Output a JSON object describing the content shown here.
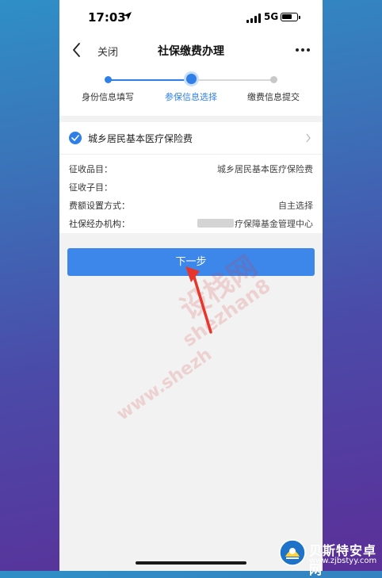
{
  "status_bar": {
    "time": "17:03",
    "network": "5G",
    "icons": [
      "location-arrow-icon",
      "signal-icon",
      "battery-icon"
    ]
  },
  "nav": {
    "close_label": "关闭",
    "title": "社保缴费办理",
    "icons": [
      "back-chevron-icon",
      "more-dots-icon"
    ]
  },
  "steps": {
    "current_index": 1,
    "items": [
      {
        "label": "身份信息填写",
        "state": "done"
      },
      {
        "label": "参保信息选择",
        "state": "active"
      },
      {
        "label": "缴费信息提交",
        "state": "pending"
      }
    ]
  },
  "plan": {
    "name": "城乡居民基本医疗保险费",
    "selected": true
  },
  "details": [
    {
      "label": "征收品目：",
      "value": "城乡居民基本医疗保险费"
    },
    {
      "label": "征收子目：",
      "value": ""
    },
    {
      "label": "费额设置方式：",
      "value": "自主选择"
    },
    {
      "label": "社保经办机构：",
      "value": "疗保障基金管理中心"
    }
  ],
  "next_button_label": "下一步",
  "watermark": {
    "line1": "设栈网",
    "line2": "shezhan8",
    "line3": "www.shezh"
  },
  "logo": {
    "name": "贝斯特安卓网",
    "url": "www.zjbstyy.com"
  },
  "colors": {
    "accent": "#3d86ea",
    "step_active": "#2f7fe8",
    "step_pending": "#c8c8c8",
    "arrow": "#e8352c"
  }
}
